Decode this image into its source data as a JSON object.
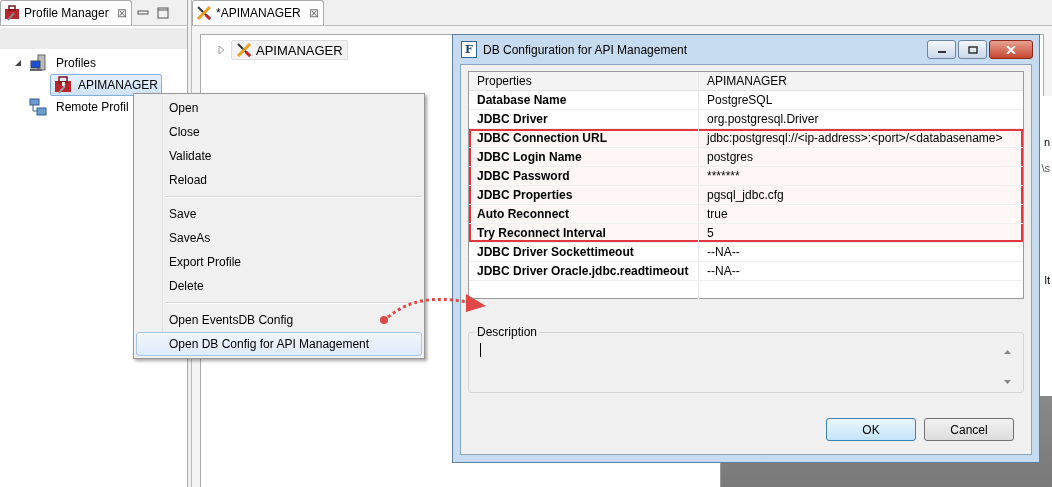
{
  "left_panel": {
    "tab": {
      "label": "Profile Manager",
      "close": "⊠"
    },
    "tree": [
      {
        "label": "Profiles",
        "expanded": true,
        "selected": false,
        "children": [
          {
            "label": "APIMANAGER",
            "selected": true
          }
        ]
      },
      {
        "label": "Remote Profil",
        "selected": false
      }
    ]
  },
  "editor": {
    "tab": {
      "label": "*APIMANAGER",
      "close": "⊠"
    },
    "tree": [
      {
        "label": "APIMANAGER",
        "expanded": false
      }
    ],
    "background_fragments": [
      "n",
      "\\s",
      "lt"
    ]
  },
  "context_menu": {
    "groups": [
      [
        {
          "label": "Open",
          "selected": false
        },
        {
          "label": "Close",
          "selected": false
        },
        {
          "label": "Validate",
          "selected": false
        },
        {
          "label": "Reload",
          "selected": false
        }
      ],
      [
        {
          "label": "Save",
          "selected": false
        },
        {
          "label": "SaveAs",
          "selected": false
        },
        {
          "label": "Export Profile",
          "selected": false
        },
        {
          "label": "Delete",
          "selected": false
        }
      ],
      [
        {
          "label": "Open EventsDB Config",
          "selected": false
        },
        {
          "label": "Open DB Config for API Management",
          "selected": true
        }
      ]
    ]
  },
  "dialog": {
    "title": "DB Configuration for API Management",
    "icon_letter": "F",
    "table": {
      "columns": [
        "Properties",
        "APIMANAGER"
      ],
      "rows": [
        {
          "property": "Database Name",
          "value": "PostgreSQL",
          "highlighted": false
        },
        {
          "property": "JDBC Driver",
          "value": "org.postgresql.Driver",
          "highlighted": false
        },
        {
          "property": "JDBC Connection URL",
          "value": "jdbc:postgresql://<ip-address>:<port>/<databasename>",
          "highlighted": true
        },
        {
          "property": "JDBC Login Name",
          "value": "postgres",
          "highlighted": true
        },
        {
          "property": "JDBC Password",
          "value": "*******",
          "highlighted": true
        },
        {
          "property": "JDBC Properties",
          "value": "pgsql_jdbc.cfg",
          "highlighted": true
        },
        {
          "property": "Auto Reconnect",
          "value": "true",
          "highlighted": true
        },
        {
          "property": "Try Reconnect Interval",
          "value": "5",
          "highlighted": true
        },
        {
          "property": "JDBC Driver Sockettimeout",
          "value": "--NA--",
          "highlighted": false
        },
        {
          "property": "JDBC Driver Oracle.jdbc.readtimeout",
          "value": "--NA--",
          "highlighted": false
        }
      ]
    },
    "description": {
      "label": "Description"
    },
    "buttons": [
      {
        "label": "OK",
        "default": true
      },
      {
        "label": "Cancel",
        "default": false
      }
    ]
  }
}
